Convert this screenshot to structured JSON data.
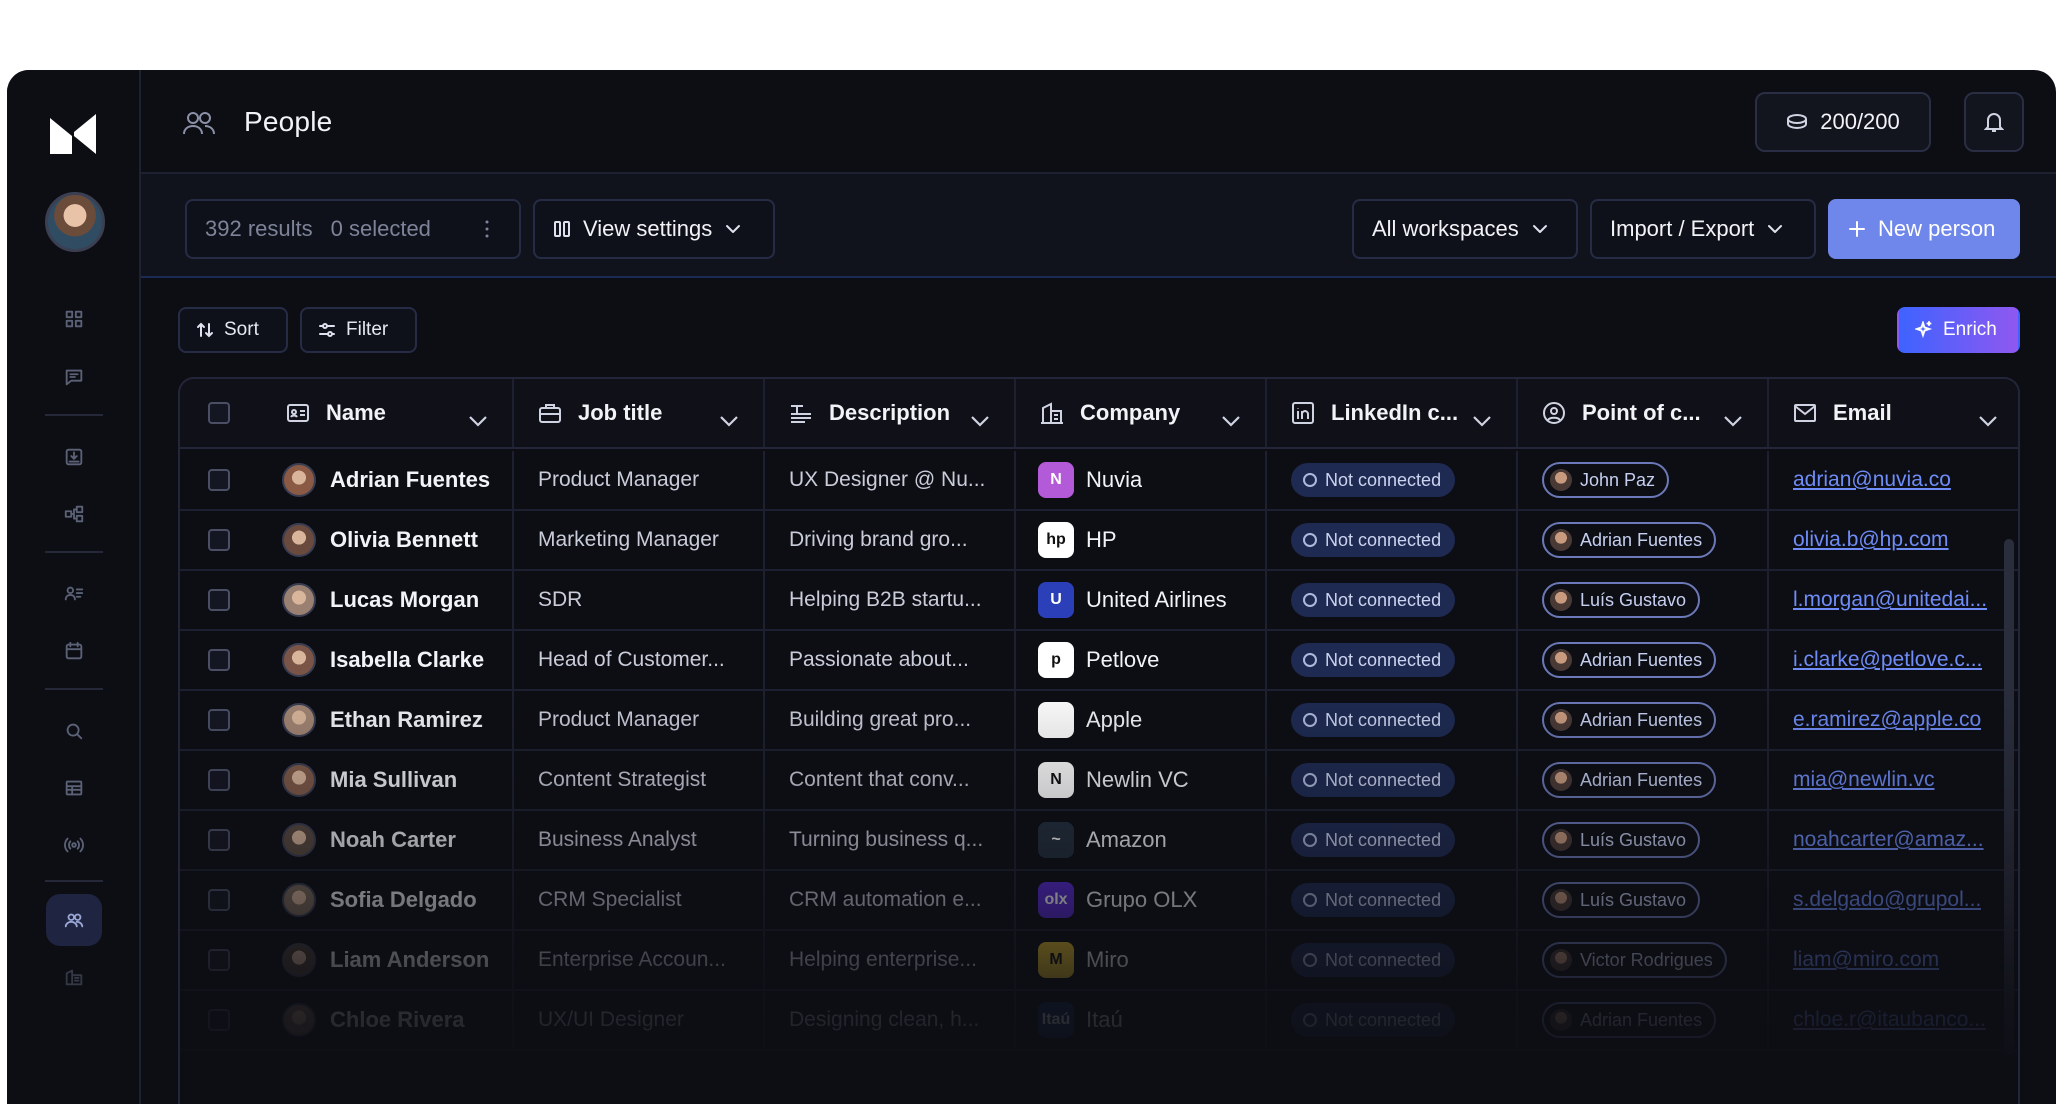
{
  "header": {
    "title": "People",
    "credits": "200/200"
  },
  "toolbar": {
    "results": "392 results",
    "selected": "0 selected",
    "view_settings": "View settings",
    "workspaces": "All workspaces",
    "import_export": "Import / Export",
    "new_person": "New person"
  },
  "filters": {
    "sort": "Sort",
    "filter": "Filter",
    "enrich": "Enrich"
  },
  "columns": [
    "Name",
    "Job title",
    "Description",
    "Company",
    "LinkedIn c...",
    "Point of c...",
    "Email"
  ],
  "rows": [
    {
      "name": "Adrian Fuentes",
      "job": "Product Manager",
      "desc": "UX Designer @ Nu...",
      "company": "Nuvia",
      "linkedin": "Not connected",
      "poc": "John Paz",
      "email": "adrian@nuvia.co"
    },
    {
      "name": "Olivia Bennett",
      "job": "Marketing Manager",
      "desc": "Driving brand gro...",
      "company": "HP",
      "linkedin": "Not connected",
      "poc": "Adrian Fuentes",
      "email": "olivia.b@hp.com"
    },
    {
      "name": "Lucas Morgan",
      "job": "SDR",
      "desc": "Helping B2B startu...",
      "company": "United Airlines",
      "linkedin": "Not connected",
      "poc": "Luís Gustavo",
      "email": "l.morgan@unitedai..."
    },
    {
      "name": "Isabella Clarke",
      "job": "Head of Customer...",
      "desc": "Passionate about...",
      "company": "Petlove",
      "linkedin": "Not connected",
      "poc": "Adrian Fuentes",
      "email": "i.clarke@petlove.c..."
    },
    {
      "name": "Ethan Ramirez",
      "job": "Product Manager",
      "desc": "Building great pro...",
      "company": "Apple",
      "linkedin": "Not connected",
      "poc": "Adrian Fuentes",
      "email": "e.ramirez@apple.co"
    },
    {
      "name": "Mia Sullivan",
      "job": "Content Strategist",
      "desc": "Content that conv...",
      "company": "Newlin VC",
      "linkedin": "Not connected",
      "poc": "Adrian Fuentes",
      "email": "mia@newlin.vc"
    },
    {
      "name": "Noah Carter",
      "job": "Business Analyst",
      "desc": "Turning business q...",
      "company": "Amazon",
      "linkedin": "Not connected",
      "poc": "Luís Gustavo",
      "email": "noahcarter@amaz..."
    },
    {
      "name": "Sofia Delgado",
      "job": "CRM Specialist",
      "desc": "CRM automation e...",
      "company": "Grupo OLX",
      "linkedin": "Not connected",
      "poc": "Luís Gustavo",
      "email": "s.delgado@grupol..."
    },
    {
      "name": "Liam Anderson",
      "job": "Enterprise Accoun...",
      "desc": "Helping enterprise...",
      "company": "Miro",
      "linkedin": "Not connected",
      "poc": "Victor Rodrigues",
      "email": "liam@miro.com"
    },
    {
      "name": "Chloe Rivera",
      "job": "UX/UI Designer",
      "desc": "Designing clean, h...",
      "company": "Itaú",
      "linkedin": "Not connected",
      "poc": "Adrian Fuentes",
      "email": "chloe.r@itaubanco..."
    }
  ],
  "company_logos": {
    "Nuvia": {
      "bg": "#b35ad8",
      "glyph": "N"
    },
    "HP": {
      "bg": "#ffffff",
      "glyph": "hp"
    },
    "United Airlines": {
      "bg": "#2b3fb8",
      "glyph": "U"
    },
    "Petlove": {
      "bg": "#ffffff",
      "glyph": "p"
    },
    "Apple": {
      "bg": "#ffffff",
      "glyph": ""
    },
    "Newlin VC": {
      "bg": "#ffffff",
      "glyph": "N"
    },
    "Amazon": {
      "bg": "#232f3e",
      "glyph": "~"
    },
    "Grupo OLX": {
      "bg": "#5a2bd8",
      "glyph": "olx"
    },
    "Miro": {
      "bg": "#f5cc2e",
      "glyph": "M"
    },
    "Itaú": {
      "bg": "#17306b",
      "glyph": "Itaú"
    }
  },
  "colors": {
    "accent": "#6f86ea",
    "link": "#6f8cf7",
    "pill_bg": "#1e2a52"
  }
}
